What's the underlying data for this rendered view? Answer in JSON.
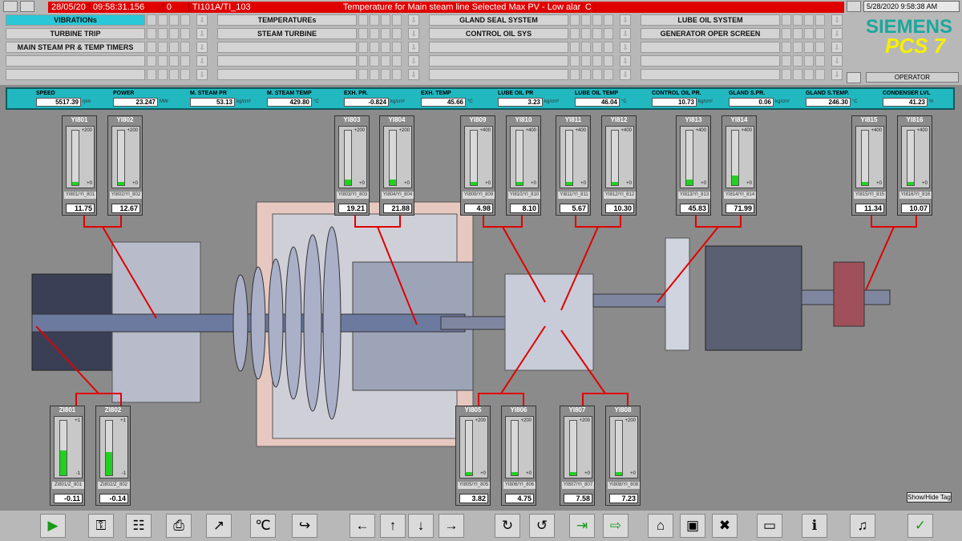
{
  "alarm": {
    "date": "28/05/20",
    "time": "09:58:31.156",
    "zero": "0",
    "tag": "TI101A/TI_103",
    "message": "Temperature for Main steam line  Selected Max PV - Low alarm",
    "code": "C"
  },
  "clock": "5/28/2020 9:58:38 AM",
  "operator": "OPERATOR",
  "brand": {
    "name": "SIEMENS",
    "product": "PCS 7"
  },
  "nav": {
    "col1": [
      "VIBRATIONs",
      "TURBINE TRIP",
      "MAIN STEAM PR & TEMP TIMERS",
      "",
      ""
    ],
    "col2": [
      "TEMPERATUREs",
      "STEAM TURBINE",
      "",
      "",
      ""
    ],
    "col3": [
      "GLAND SEAL SYSTEM",
      "CONTROL OIL SYS",
      "",
      "",
      ""
    ],
    "col4": [
      "LUBE OIL SYSTEM",
      "GENERATOR OPER SCREEN",
      "",
      "",
      ""
    ]
  },
  "values": [
    {
      "label": "SPEED",
      "value": "5517.39",
      "unit": "rpm"
    },
    {
      "label": "POWER",
      "value": "23.247",
      "unit": "MW"
    },
    {
      "label": "M. STEAM PR",
      "value": "53.13",
      "unit": "kg/cm²"
    },
    {
      "label": "M. STEAM TEMP",
      "value": "429.80",
      "unit": "°C"
    },
    {
      "label": "EXH. PR.",
      "value": "-0.824",
      "unit": "kg/cm²"
    },
    {
      "label": "EXH. TEMP",
      "value": "45.66",
      "unit": "°C"
    },
    {
      "label": "LUBE OIL PR",
      "value": "3.23",
      "unit": "kg/cm²"
    },
    {
      "label": "LUBE OIL TEMP",
      "value": "46.04",
      "unit": "°C"
    },
    {
      "label": "CONTROL OIL PR.",
      "value": "10.73",
      "unit": "kg/cm²"
    },
    {
      "label": "GLAND S.PR.",
      "value": "0.06",
      "unit": "kg/cm²"
    },
    {
      "label": "GLAND S.TEMP.",
      "value": "246.30",
      "unit": "°C"
    },
    {
      "label": "CONDENSER LVL",
      "value": "41.23",
      "unit": "%"
    }
  ],
  "gauges": [
    {
      "id": "YI801",
      "max": "+200",
      "min": "+0",
      "tag": "YI801/YI_801",
      "value": "11.75",
      "fill": 0.06
    },
    {
      "id": "YI802",
      "max": "+200",
      "min": "+0",
      "tag": "YI802/YI_802",
      "value": "12.67",
      "fill": 0.06
    },
    {
      "id": "YI803",
      "max": "+200",
      "min": "+0",
      "tag": "YI803/YI_803",
      "value": "19.21",
      "fill": 0.1
    },
    {
      "id": "YI804",
      "max": "+200",
      "min": "+0",
      "tag": "YI804/YI_804",
      "value": "21.88",
      "fill": 0.11
    },
    {
      "id": "YI809",
      "max": "+400",
      "min": "+0",
      "tag": "YI809/YI_809",
      "value": "4.98",
      "fill": 0.01
    },
    {
      "id": "YI810",
      "max": "+400",
      "min": "+0",
      "tag": "YI810/YI_810",
      "value": "8.10",
      "fill": 0.02
    },
    {
      "id": "YI811",
      "max": "+400",
      "min": "+0",
      "tag": "YI811/YI_811",
      "value": "5.67",
      "fill": 0.01
    },
    {
      "id": "YI812",
      "max": "+400",
      "min": "+0",
      "tag": "YI812/YI_812",
      "value": "10.30",
      "fill": 0.03
    },
    {
      "id": "YI813",
      "max": "+400",
      "min": "+0",
      "tag": "YI813/YI_813",
      "value": "45.83",
      "fill": 0.11
    },
    {
      "id": "YI814",
      "max": "+400",
      "min": "+0",
      "tag": "YI814/YI_814",
      "value": "71.99",
      "fill": 0.18
    },
    {
      "id": "YI815",
      "max": "+400",
      "min": "+0",
      "tag": "YI815/YI_815",
      "value": "11.34",
      "fill": 0.03
    },
    {
      "id": "YI816",
      "max": "+400",
      "min": "+0",
      "tag": "YI816/YI_816",
      "value": "10.07",
      "fill": 0.03
    },
    {
      "id": "ZI801",
      "max": "+1",
      "min": "-1",
      "tag": "ZI801/Z_801",
      "value": "-0.11",
      "fill": 0.45
    },
    {
      "id": "ZI802",
      "max": "+1",
      "min": "-1",
      "tag": "ZI802/Z_802",
      "value": "-0.14",
      "fill": 0.43
    },
    {
      "id": "YI805",
      "max": "+200",
      "min": "+0",
      "tag": "YI805/YI_805",
      "value": "3.82",
      "fill": 0.02
    },
    {
      "id": "YI806",
      "max": "+200",
      "min": "+0",
      "tag": "YI806/YI_806",
      "value": "4.75",
      "fill": 0.02
    },
    {
      "id": "YI807",
      "max": "+200",
      "min": "+0",
      "tag": "YI807/YI_807",
      "value": "7.58",
      "fill": 0.04
    },
    {
      "id": "YI808",
      "max": "+200",
      "min": "+0",
      "tag": "YI808/YI_808",
      "value": "7.23",
      "fill": 0.04
    }
  ],
  "showhide": "Show/Hide Tag",
  "toolbar": [
    "play-icon",
    "key-icon",
    "notes-icon",
    "print-icon",
    "trend-icon",
    "thermometer-icon",
    "export-icon",
    "back-icon",
    "up-icon",
    "down-icon",
    "forward-icon",
    "refresh-icon",
    "redo-icon",
    "in-icon",
    "out-icon",
    "folder-icon",
    "save-icon",
    "delete-icon",
    "screen-icon",
    "info-icon",
    "sound-icon",
    "ack-icon"
  ],
  "colors": {
    "accent": "#21b8c0",
    "alarm": "#e00000",
    "fill": "#22d022",
    "brand": "#1aa89e",
    "brandYellow": "#f6f000"
  }
}
